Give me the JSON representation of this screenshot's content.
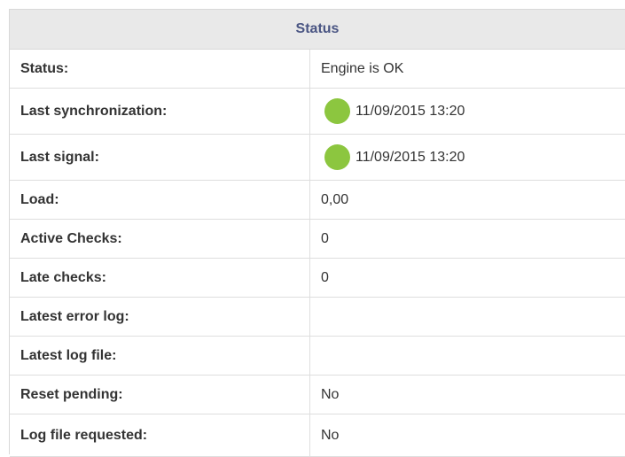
{
  "status_panel": {
    "title": "Status",
    "status_color": "#8cc63f",
    "rows": [
      {
        "label": "Status:",
        "value": "Engine is OK"
      },
      {
        "label": "Last synchronization:",
        "value": "11/09/2015 13:20",
        "icon": "green-status-dot-icon"
      },
      {
        "label": "Last signal:",
        "value": "11/09/2015 13:20",
        "icon": "green-status-dot-icon"
      },
      {
        "label": "Load:",
        "value": "0,00"
      },
      {
        "label": "Active Checks:",
        "value": "0"
      },
      {
        "label": "Late checks:",
        "value": "0"
      },
      {
        "label": "Latest error log:",
        "value": ""
      },
      {
        "label": "Latest log file:",
        "value": ""
      },
      {
        "label": "Reset pending:",
        "value": "No"
      },
      {
        "label": "Log file requested:",
        "value": "No"
      }
    ]
  }
}
